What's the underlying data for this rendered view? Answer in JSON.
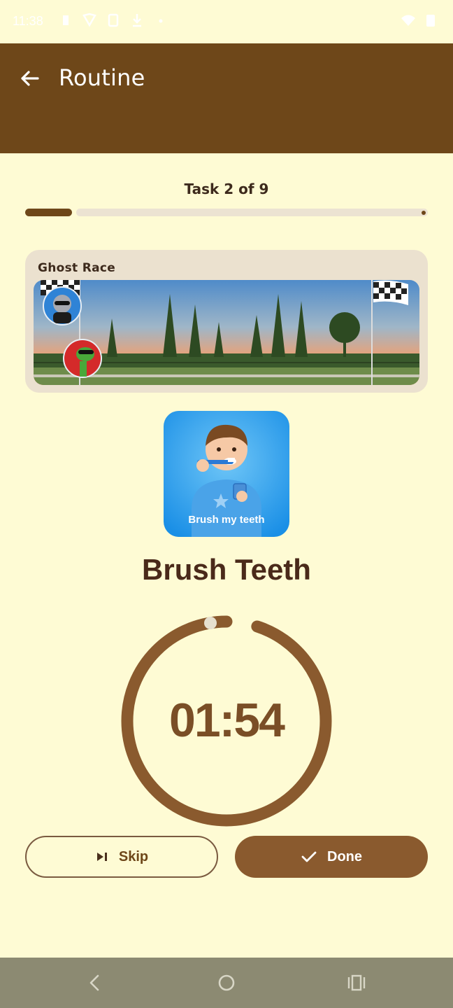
{
  "status_bar": {
    "time": "11:38",
    "left_icons": [
      "notification-icon",
      "shield-icon",
      "clipboard-icon",
      "download-icon",
      "dot-icon"
    ],
    "right_icons": [
      "wifi-icon",
      "battery-icon"
    ]
  },
  "app_bar": {
    "title": "Routine",
    "back_icon": "arrow-left-icon"
  },
  "progress": {
    "label": "Task 2 of 9",
    "current": 2,
    "total": 9
  },
  "ghost_race": {
    "title": "Ghost Race",
    "racers": [
      "cat-avatar",
      "dinosaur-avatar"
    ],
    "flags": [
      "start-flag-icon",
      "finish-flag-icon"
    ]
  },
  "task": {
    "image_caption": "Brush my teeth",
    "name": "Brush Teeth"
  },
  "timer": {
    "display": "01:54",
    "remaining_fraction": 0.95
  },
  "buttons": {
    "skip_label": "Skip",
    "done_label": "Done"
  },
  "nav": {
    "back": "back-icon",
    "home": "home-icon",
    "recents": "recents-icon"
  },
  "colors": {
    "background": "#fefbd4",
    "app_bar": "#6e4719",
    "accent": "#8a5a2e",
    "track": "#ece3d2"
  }
}
